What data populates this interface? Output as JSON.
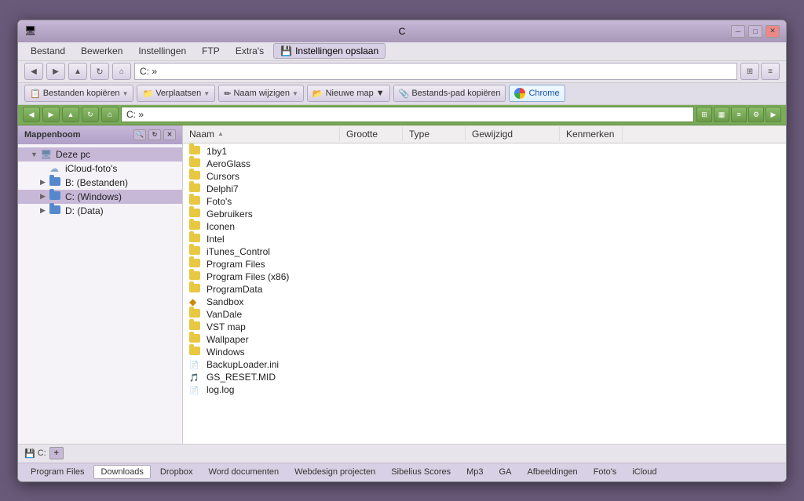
{
  "window": {
    "title": "C",
    "titlebar_icon": "🖥"
  },
  "menu": {
    "items": [
      "Bestand",
      "Bewerken",
      "Instellingen",
      "FTP",
      "Extra's",
      "Instellingen opslaan"
    ]
  },
  "toolbar1": {
    "address": "C: »",
    "address_prefix": "C: »"
  },
  "toolbar2": {
    "bestanden_kopieren": "Bestanden kopiëren",
    "verplaatsen": "Verplaatsen",
    "naam_wijzigen": "Naam wijzigen",
    "nieuwe_map": "Nieuwe map",
    "bestands_pad": "Bestands-pad kopiëren",
    "chrome": "Chrome"
  },
  "toolbar3": {
    "address": "C: »"
  },
  "sidebar": {
    "title": "Mappenboom",
    "items": [
      {
        "label": "Deze pc",
        "level": 0,
        "type": "computer",
        "expanded": true
      },
      {
        "label": "iCloud-foto's",
        "level": 1,
        "type": "icloud"
      },
      {
        "label": "B: (Bestanden)",
        "level": 1,
        "type": "folder-blue"
      },
      {
        "label": "C: (Windows)",
        "level": 1,
        "type": "folder-blue",
        "selected": true
      },
      {
        "label": "D: (Data)",
        "level": 1,
        "type": "folder-blue"
      }
    ]
  },
  "file_list": {
    "columns": [
      "Naam",
      "Grootte",
      "Type",
      "Gewijzigd",
      "Kenmerken"
    ],
    "files": [
      {
        "name": "1by1",
        "size": "",
        "type": "",
        "date": "",
        "attr": "",
        "icon": "folder"
      },
      {
        "name": "AeroGlass",
        "size": "",
        "type": "",
        "date": "",
        "attr": "",
        "icon": "folder"
      },
      {
        "name": "Cursors",
        "size": "",
        "type": "",
        "date": "",
        "attr": "",
        "icon": "folder"
      },
      {
        "name": "Delphi7",
        "size": "",
        "type": "",
        "date": "",
        "attr": "",
        "icon": "folder"
      },
      {
        "name": "Foto's",
        "size": "",
        "type": "",
        "date": "",
        "attr": "",
        "icon": "folder"
      },
      {
        "name": "Gebruikers",
        "size": "",
        "type": "",
        "date": "",
        "attr": "",
        "icon": "folder"
      },
      {
        "name": "Iconen",
        "size": "",
        "type": "",
        "date": "",
        "attr": "",
        "icon": "folder"
      },
      {
        "name": "Intel",
        "size": "",
        "type": "",
        "date": "",
        "attr": "",
        "icon": "folder"
      },
      {
        "name": "iTunes_Control",
        "size": "",
        "type": "",
        "date": "",
        "attr": "",
        "icon": "folder"
      },
      {
        "name": "Program Files",
        "size": "",
        "type": "",
        "date": "",
        "attr": "",
        "icon": "folder"
      },
      {
        "name": "Program Files (x86)",
        "size": "",
        "type": "",
        "date": "",
        "attr": "",
        "icon": "folder"
      },
      {
        "name": "ProgramData",
        "size": "",
        "type": "",
        "date": "",
        "attr": "",
        "icon": "folder"
      },
      {
        "name": "Sandbox",
        "size": "",
        "type": "",
        "date": "",
        "attr": "",
        "icon": "diamond"
      },
      {
        "name": "VanDale",
        "size": "",
        "type": "",
        "date": "",
        "attr": "",
        "icon": "folder"
      },
      {
        "name": "VST map",
        "size": "",
        "type": "",
        "date": "",
        "attr": "",
        "icon": "folder"
      },
      {
        "name": "Wallpaper",
        "size": "",
        "type": "",
        "date": "",
        "attr": "",
        "icon": "folder"
      },
      {
        "name": "Windows",
        "size": "",
        "type": "",
        "date": "",
        "attr": "",
        "icon": "folder"
      },
      {
        "name": "BackupLoader.ini",
        "size": "",
        "type": "",
        "date": "",
        "attr": "",
        "icon": "ini"
      },
      {
        "name": "GS_RESET.MID",
        "size": "",
        "type": "",
        "date": "",
        "attr": "",
        "icon": "mid"
      },
      {
        "name": "log.log",
        "size": "",
        "type": "",
        "date": "",
        "attr": "",
        "icon": "txt"
      }
    ]
  },
  "bottom_drive": {
    "label": "C:"
  },
  "bookmarks": {
    "items": [
      {
        "label": "Program Files",
        "active": false
      },
      {
        "label": "Downloads",
        "active": true
      },
      {
        "label": "Dropbox",
        "active": false
      },
      {
        "label": "Word documenten",
        "active": false
      },
      {
        "label": "Webdesign projecten",
        "active": false
      },
      {
        "label": "Sibelius Scores",
        "active": false
      },
      {
        "label": "Mp3",
        "active": false
      },
      {
        "label": "GA",
        "active": false
      },
      {
        "label": "Afbeeldingen",
        "active": false
      },
      {
        "label": "Foto's",
        "active": false
      },
      {
        "label": "iCloud",
        "active": false
      }
    ]
  }
}
